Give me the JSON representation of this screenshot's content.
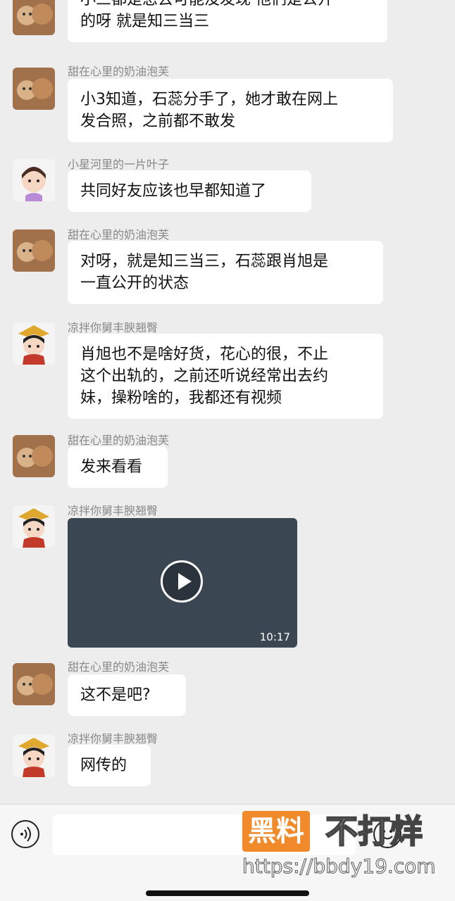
{
  "messages": [
    {
      "sender": "",
      "avatar": "cat-avatar",
      "lines": [
        "小三都是您去可能没发现 他们是公开",
        "的呀 就是知三当三"
      ]
    },
    {
      "sender": "甜在心里的奶油泡芙",
      "avatar": "cat-avatar",
      "lines": [
        "小3知道，石蕊分手了，她才敢在网上",
        "发合照，之前都不敢发"
      ]
    },
    {
      "sender": "小星河里的一片叶子",
      "avatar": "girl-avatar",
      "lines": [
        "共同好友应该也早都知道了"
      ]
    },
    {
      "sender": "甜在心里的奶油泡芙",
      "avatar": "cat-avatar",
      "lines": [
        "对呀，就是知三当三，石蕊跟肖旭是",
        "一直公开的状态"
      ]
    },
    {
      "sender": "凉拌你舅丰腴翘臀",
      "avatar": "scholar-avatar",
      "lines": [
        "肖旭也不是啥好货，花心的很，不止",
        "这个出轨的，之前还听说经常出去约",
        "妹，操粉啥的，我都还有视频"
      ]
    },
    {
      "sender": "甜在心里的奶油泡芙",
      "avatar": "cat-avatar",
      "lines": [
        "发来看看"
      ]
    },
    {
      "sender": "凉拌你舅丰腴翘臀",
      "avatar": "scholar-avatar",
      "video": {
        "duration": "10:17"
      }
    },
    {
      "sender": "甜在心里的奶油泡芙",
      "avatar": "cat-avatar",
      "lines": [
        "这不是吧?"
      ]
    },
    {
      "sender": "凉拌你舅丰腴翘臀",
      "avatar": "scholar-avatar",
      "lines": [
        "网传的"
      ]
    }
  ],
  "input_bar": {
    "text": ""
  },
  "watermark": {
    "badge": "黑料",
    "title": "不打烊",
    "url": "https://bbdy19.com"
  }
}
